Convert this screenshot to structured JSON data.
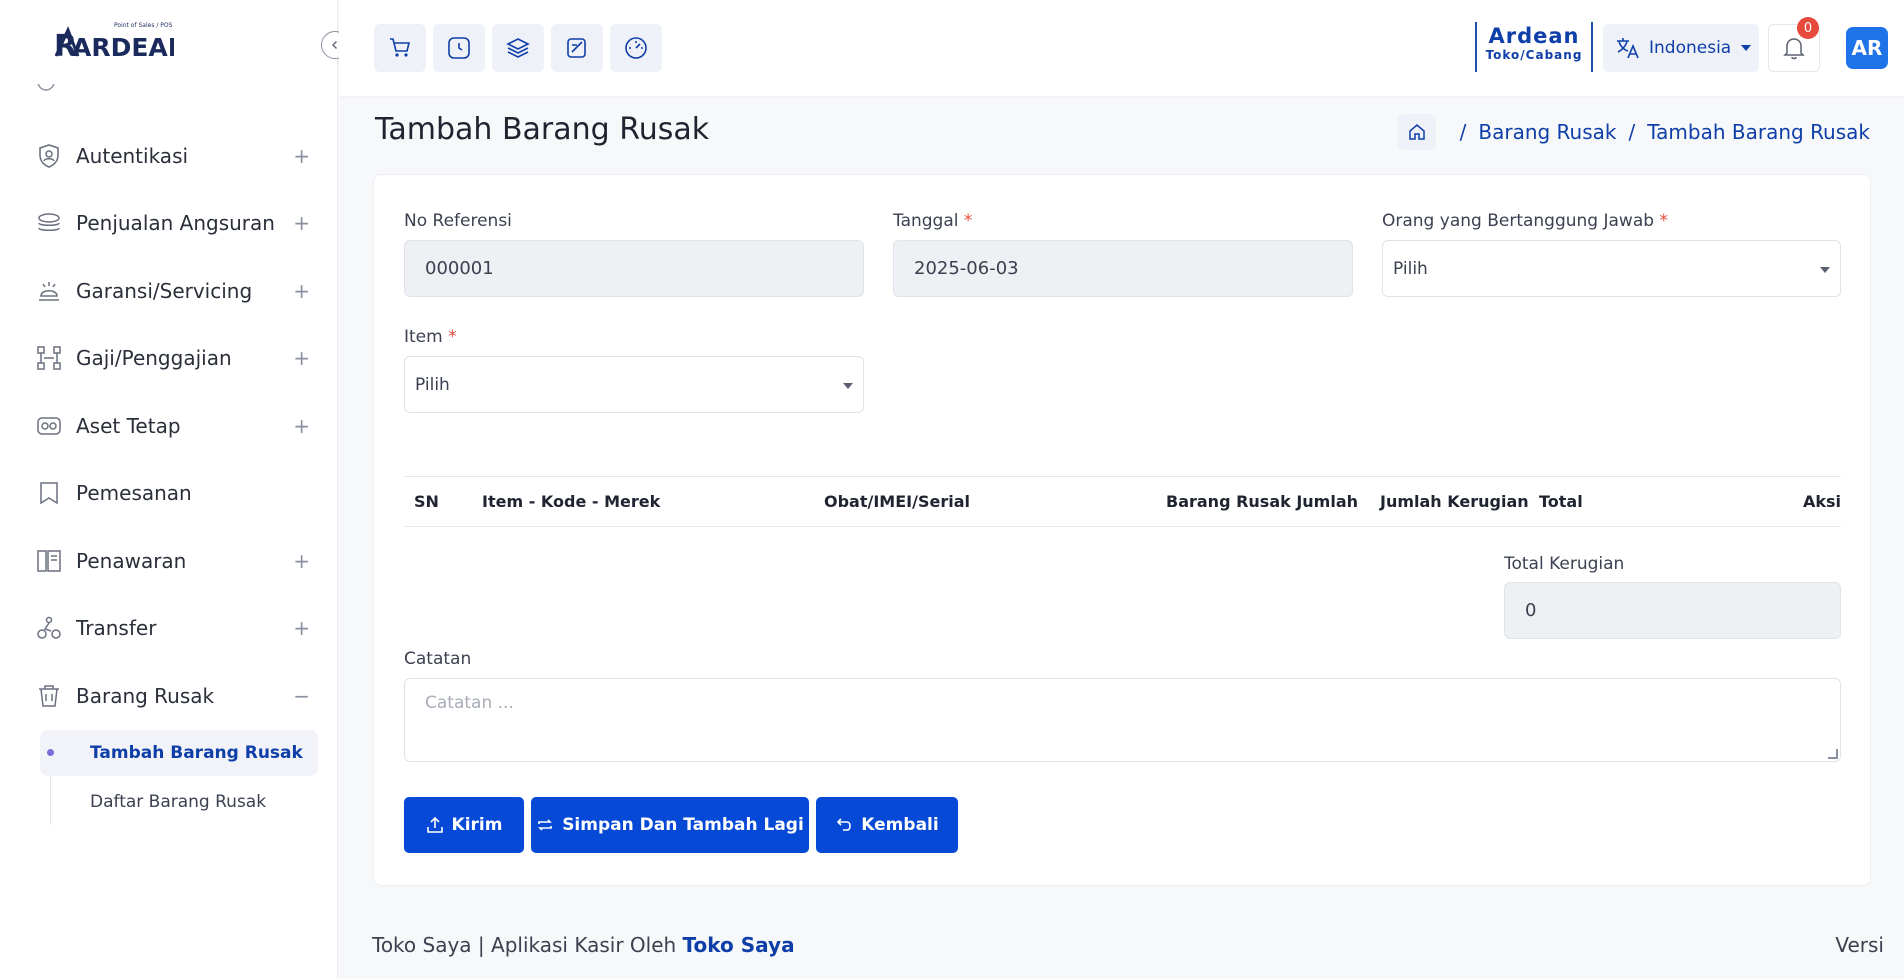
{
  "app": {
    "logo_text": "RARDEAN",
    "logo_tagline": "Point of Sales / POS"
  },
  "sidebar": {
    "items": [
      {
        "label": "Autentikasi",
        "toggle": "+",
        "icon": "shield-user-icon"
      },
      {
        "label": "Penjualan Angsuran",
        "toggle": "+",
        "icon": "stack-coins-icon"
      },
      {
        "label": "Garansi/Servicing",
        "toggle": "+",
        "icon": "service-icon"
      },
      {
        "label": "Gaji/Penggajian",
        "toggle": "+",
        "icon": "org-chart-icon"
      },
      {
        "label": "Aset Tetap",
        "toggle": "+",
        "icon": "assets-icon"
      },
      {
        "label": "Pemesanan",
        "toggle": "",
        "icon": "bookmark-icon"
      },
      {
        "label": "Penawaran",
        "toggle": "+",
        "icon": "offer-icon"
      },
      {
        "label": "Transfer",
        "toggle": "+",
        "icon": "transfer-icon"
      },
      {
        "label": "Barang Rusak",
        "toggle": "−",
        "icon": "trash-icon"
      }
    ],
    "submenu": [
      {
        "label": "Tambah Barang Rusak",
        "active": true
      },
      {
        "label": "Daftar Barang Rusak",
        "active": false
      }
    ]
  },
  "topbar": {
    "store_name": "Ardean",
    "store_sub": "Toko/Cabang",
    "language": "Indonesia",
    "notif_count": "0",
    "avatar_initials": "AR"
  },
  "page": {
    "title": "Tambah Barang Rusak",
    "breadcrumb": [
      "Barang Rusak",
      "Tambah Barang Rusak"
    ]
  },
  "form": {
    "no_ref_label": "No Referensi",
    "no_ref_value": "000001",
    "tanggal_label": "Tanggal",
    "tanggal_value": "2025-06-03",
    "pj_label": "Orang yang Bertanggung Jawab",
    "pj_value": "Pilih",
    "item_label": "Item",
    "item_value": "Pilih",
    "required_mark": "*",
    "table_headers": [
      "SN",
      "Item - Kode - Merek",
      "Obat/IMEI/Serial",
      "Barang Rusak Jumlah",
      "Jumlah Kerugian",
      "Total",
      "Aksi"
    ],
    "total_label": "Total Kerugian",
    "total_value": "0",
    "catatan_label": "Catatan",
    "catatan_placeholder": "Catatan ...",
    "buttons": {
      "submit": "Kirim",
      "save_more": "Simpan Dan Tambah Lagi",
      "back": "Kembali"
    }
  },
  "footer": {
    "text": "Toko Saya | Aplikasi Kasir Oleh ",
    "link": "Toko Saya",
    "right": "Versi"
  },
  "colors": {
    "primary": "#0649d6",
    "brand_text": "#0e3ea8",
    "badge": "#e64a3c"
  }
}
